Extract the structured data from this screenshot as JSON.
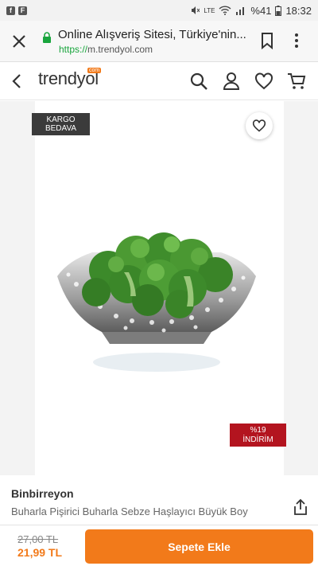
{
  "status_bar": {
    "battery": "%41",
    "time": "18:32",
    "network": "LTE",
    "left_icons": [
      "facebook-icon",
      "flipboard-icon"
    ]
  },
  "browser": {
    "title": "Online Alışveriş Sitesi, Türkiye'nin...",
    "url_scheme": "https://",
    "url_host": "m.trendyol.com"
  },
  "header": {
    "logo_text": "trendyol",
    "logo_badge": "com",
    "icons": [
      "search-icon",
      "account-icon",
      "favorites-icon",
      "cart-icon"
    ]
  },
  "product": {
    "cargo_badge_line1": "KARGO",
    "cargo_badge_line2": "BEDAVA",
    "discount_line1": "%19",
    "discount_line2": "İNDİRİM",
    "brand": "Binbirreyon",
    "name": "Buharla Pişirici Buharla Sebze Haşlayıcı Büyük Boy"
  },
  "purchase": {
    "old_price": "27,00 TL",
    "new_price": "21,99 TL",
    "add_to_cart_label": "Sepete Ekle"
  },
  "colors": {
    "brand_orange": "#f27a1a",
    "discount_red": "#b3141f",
    "badge_dark": "#3b3b3b"
  }
}
